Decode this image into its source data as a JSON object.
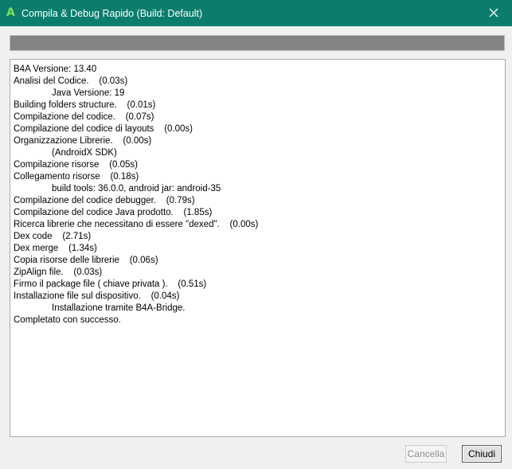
{
  "window": {
    "title": "Compila & Debug Rapido (Build: Default)",
    "icon_glyph": "A",
    "icon_name": "b4a-app-icon",
    "close_icon": "close-icon",
    "titlebar_color": "#0a7d6c"
  },
  "progress": {
    "value": 1.0
  },
  "log": {
    "lines": [
      {
        "text": "B4A Versione: 13.40",
        "indent": false
      },
      {
        "text": "Analisi del Codice.    (0.03s)",
        "indent": false
      },
      {
        "text": "Java Versione: 19",
        "indent": true
      },
      {
        "text": "Building folders structure.    (0.01s)",
        "indent": false
      },
      {
        "text": "Compilazione del codice.    (0.07s)",
        "indent": false
      },
      {
        "text": "Compilazione del codice di layouts    (0.00s)",
        "indent": false
      },
      {
        "text": "Organizzazione Librerie.    (0.00s)",
        "indent": false
      },
      {
        "text": "(AndroidX SDK)",
        "indent": true
      },
      {
        "text": "Compilazione risorse    (0.05s)",
        "indent": false
      },
      {
        "text": "Collegamento risorse    (0.18s)",
        "indent": false
      },
      {
        "text": "build tools: 36.0.0, android jar: android-35",
        "indent": true
      },
      {
        "text": "Compilazione del codice debugger.    (0.79s)",
        "indent": false
      },
      {
        "text": "Compilazione del codice Java prodotto.    (1.85s)",
        "indent": false
      },
      {
        "text": "Ricerca librerie che necessitano di essere \"dexed\".    (0.00s)",
        "indent": false
      },
      {
        "text": "Dex code    (2.71s)",
        "indent": false
      },
      {
        "text": "Dex merge    (1.34s)",
        "indent": false
      },
      {
        "text": "Copia risorse delle librerie    (0.06s)",
        "indent": false
      },
      {
        "text": "ZipAlign file.    (0.03s)",
        "indent": false
      },
      {
        "text": "Firmo il package file ( chiave privata ).    (0.51s)",
        "indent": false
      },
      {
        "text": "Installazione file sul dispositivo.    (0.04s)",
        "indent": false
      },
      {
        "text": "Installazione tramite B4A-Bridge.",
        "indent": true
      },
      {
        "text": "Completato con successo.",
        "indent": false
      }
    ]
  },
  "buttons": {
    "cancel_label": "Cancella",
    "cancel_enabled": false,
    "close_label": "Chiudi"
  }
}
